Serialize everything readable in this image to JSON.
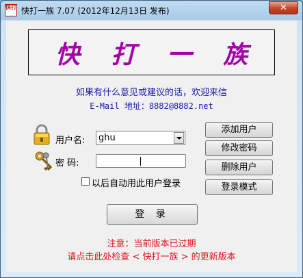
{
  "window": {
    "title": "快打一族 7.07 (2012年12月13日 发布)",
    "icon_label": "快打",
    "close_label": "✕"
  },
  "banner": {
    "chars": [
      "快",
      "打",
      "一",
      "族"
    ]
  },
  "info": {
    "line1": "如果有什么意见或建议的话，欢迎来信",
    "line2": "E-Mail 地址：8882@8882.net"
  },
  "form": {
    "username_label": "用户名:",
    "username_value": "ghu",
    "password_label": "密  码:",
    "auto_login_label": "以后自动用此用户登录",
    "auto_login_checked": false,
    "login_button": "登 录"
  },
  "side_buttons": {
    "add_user": "添加用户",
    "edit_password": "修改密码",
    "delete_user": "删除用户",
    "login_mode": "登录模式"
  },
  "notice": {
    "line1": "注意：当前版本已过期",
    "line2": "请点击此处检查 < 快打一族 > 的更新版本"
  },
  "colors": {
    "banner_text": "#a300a8",
    "info_text": "#1a20a8",
    "notice_text": "#e0121a"
  }
}
